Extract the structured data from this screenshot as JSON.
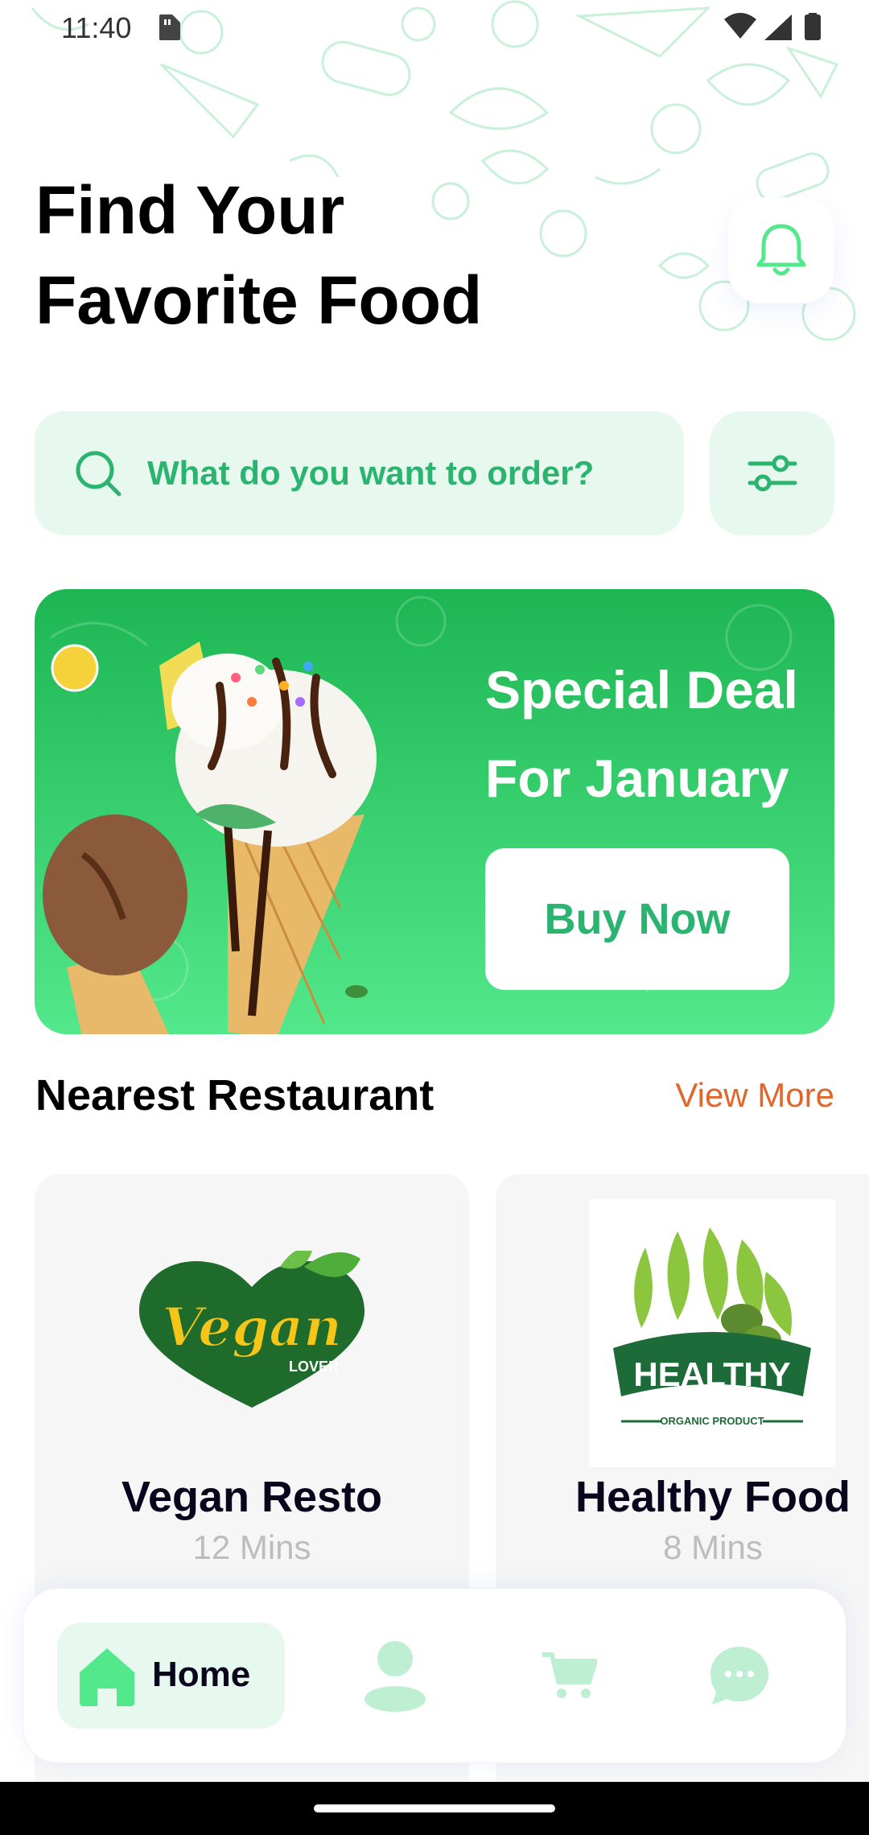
{
  "status_bar": {
    "time": "11:40"
  },
  "header": {
    "title_line1": "Find Your",
    "title_line2": "Favorite Food",
    "icons": {
      "notification": "bell-icon"
    }
  },
  "search": {
    "placeholder": "What do you want to order?",
    "value": "",
    "icons": {
      "search": "search-icon",
      "filter": "filter-icon"
    }
  },
  "promo": {
    "title_line1": "Special Deal",
    "title_line2": "For January",
    "button_label": "Buy Now"
  },
  "nearest": {
    "title": "Nearest Restaurant",
    "view_more": "View More",
    "restaurants": [
      {
        "name": "Vegan Resto",
        "time": "12 Mins",
        "logo_word": "Vegan",
        "logo_sub": "LOVER"
      },
      {
        "name": "Healthy Food",
        "time": "8 Mins",
        "logo_word": "HEALTHY",
        "logo_sub": "ORGANIC PRODUCT"
      }
    ]
  },
  "bottom_nav": {
    "home_label": "Home",
    "items": [
      "home-icon",
      "profile-icon",
      "cart-icon",
      "chat-icon"
    ]
  },
  "colors": {
    "accent": "#53E88B",
    "accent_dark": "#2BB46F",
    "accent_light": "#E7F8EF",
    "link": "#E0662C"
  }
}
